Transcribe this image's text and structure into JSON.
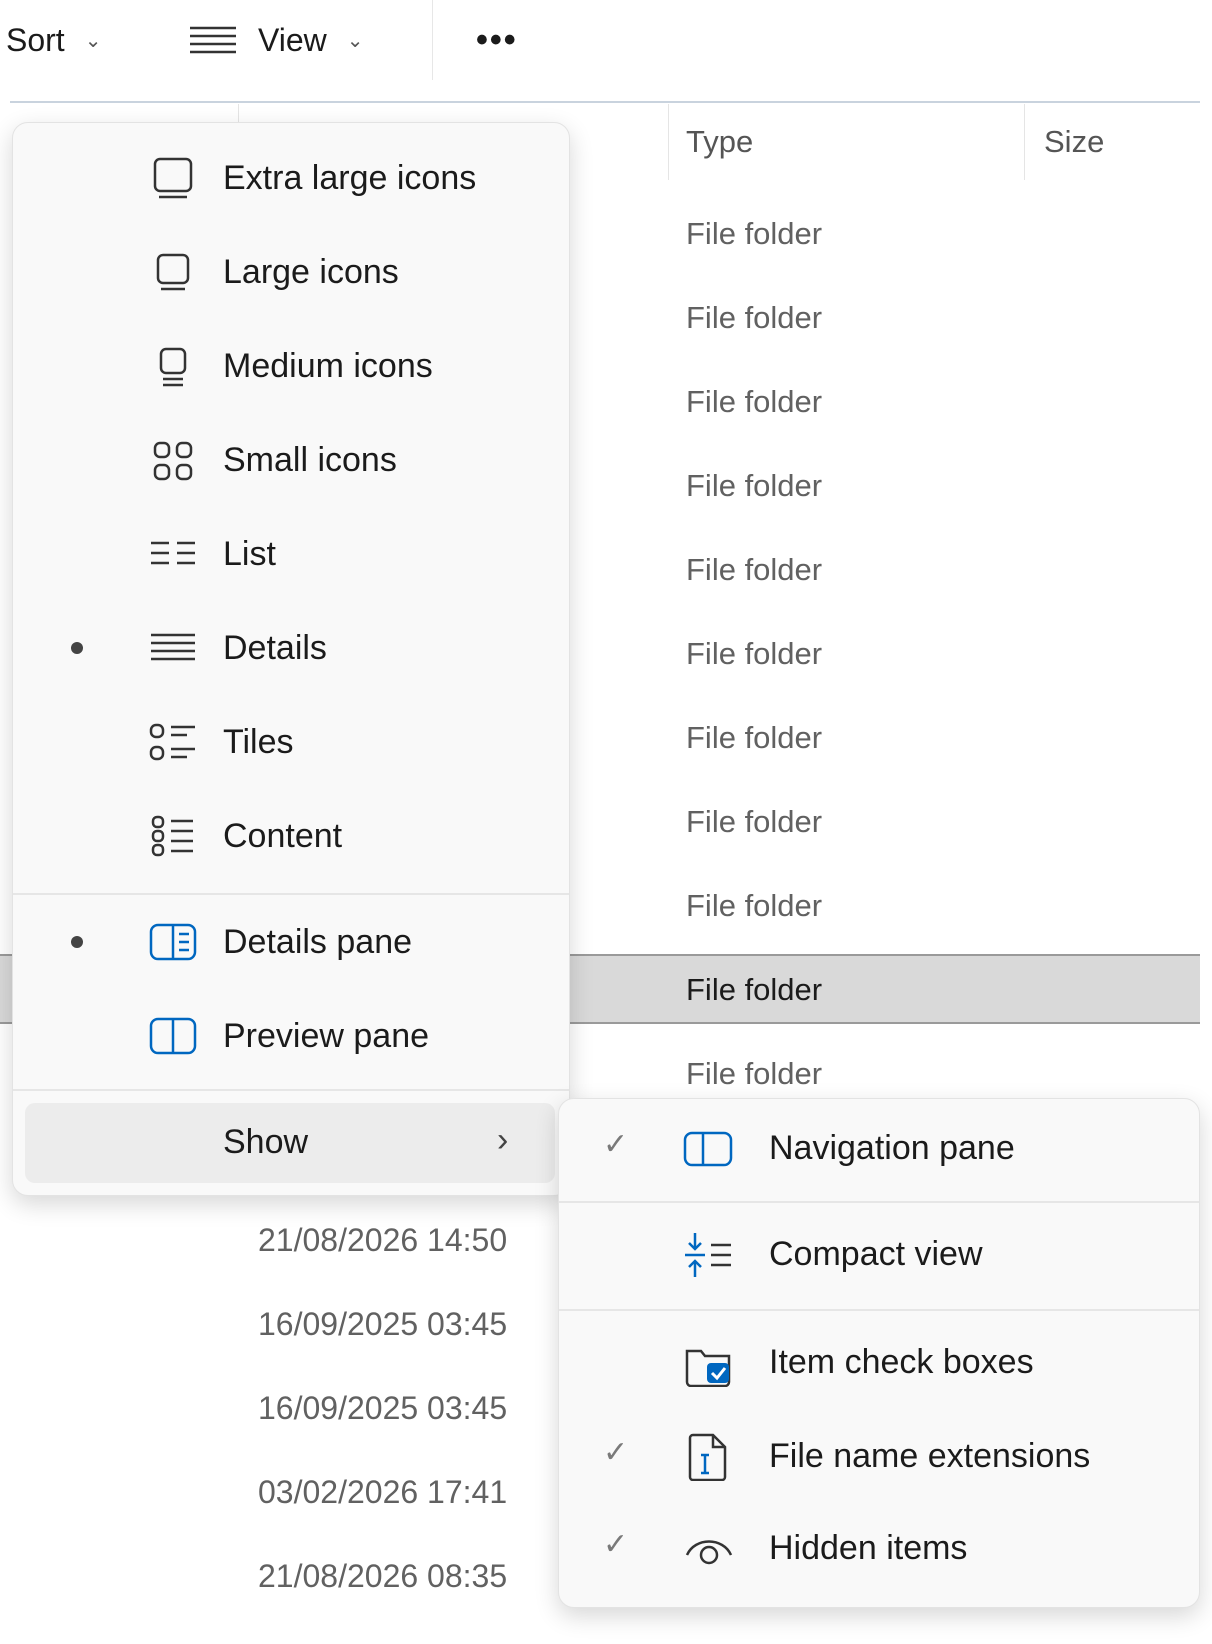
{
  "toolbar": {
    "sort_label": "Sort",
    "view_label": "View",
    "more_label": "•••"
  },
  "file_list": {
    "columns": [
      "Type",
      "Size"
    ],
    "type_rows": [
      "File folder",
      "File folder",
      "File folder",
      "File folder",
      "File folder",
      "File folder",
      "File folder",
      "File folder",
      "File folder",
      "File folder",
      "File folder"
    ],
    "selected_row_index": 9,
    "dates": [
      "21/08/2026 14:50",
      "16/09/2025 03:45",
      "16/09/2025 03:45",
      "03/02/2026 17:41",
      "21/08/2026 08:35"
    ]
  },
  "view_menu": {
    "layout_items": [
      {
        "label": "Extra large icons",
        "icon": "extra-large-icons-icon",
        "selected": false
      },
      {
        "label": "Large icons",
        "icon": "large-icons-icon",
        "selected": false
      },
      {
        "label": "Medium icons",
        "icon": "medium-icons-icon",
        "selected": false
      },
      {
        "label": "Small icons",
        "icon": "small-icons-icon",
        "selected": false
      },
      {
        "label": "List",
        "icon": "list-icon",
        "selected": false
      },
      {
        "label": "Details",
        "icon": "details-icon",
        "selected": true
      },
      {
        "label": "Tiles",
        "icon": "tiles-icon",
        "selected": false
      },
      {
        "label": "Content",
        "icon": "content-icon",
        "selected": false
      }
    ],
    "pane_items": [
      {
        "label": "Details pane",
        "icon": "details-pane-icon",
        "selected": true
      },
      {
        "label": "Preview pane",
        "icon": "preview-pane-icon",
        "selected": false
      }
    ],
    "show_label": "Show",
    "show_arrow": "›"
  },
  "show_submenu": {
    "items": [
      {
        "label": "Navigation pane",
        "icon": "navigation-pane-icon",
        "checked": true
      },
      {
        "label": "Compact view",
        "icon": "compact-view-icon",
        "checked": false
      },
      {
        "label": "Item check boxes",
        "icon": "item-check-boxes-icon",
        "checked": false
      },
      {
        "label": "File name extensions",
        "icon": "file-name-extensions-icon",
        "checked": true
      },
      {
        "label": "Hidden items",
        "icon": "hidden-items-icon",
        "checked": true
      }
    ],
    "check_glyph": "✓"
  },
  "colors": {
    "accent": "#0067c0",
    "selected_row": "#d9d9d9",
    "menu_bg": "#f9f9f9"
  }
}
